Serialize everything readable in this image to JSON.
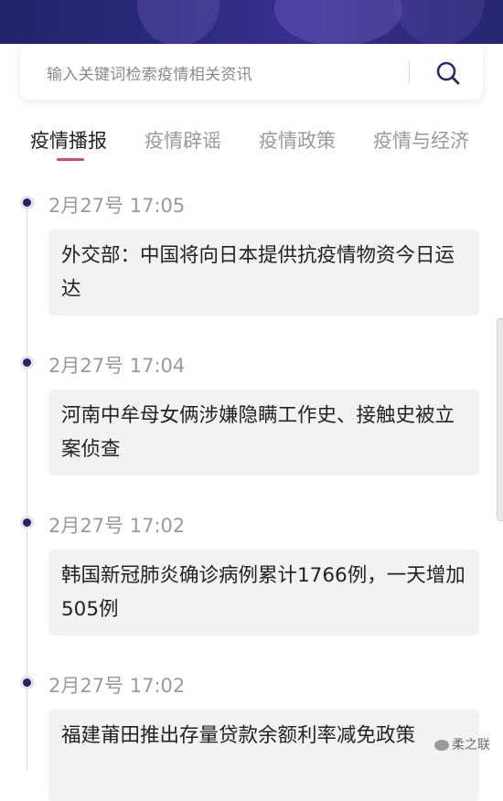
{
  "search": {
    "placeholder": "输入关键词检索疫情相关资讯",
    "icon": "search-icon"
  },
  "tabs": [
    {
      "label": "疫情播报",
      "active": true
    },
    {
      "label": "疫情辟谣",
      "active": false
    },
    {
      "label": "疫情政策",
      "active": false
    },
    {
      "label": "疫情与经济",
      "active": false
    }
  ],
  "timeline": [
    {
      "time": "2月27号 17:05",
      "text": "外交部：中国将向日本提供抗疫情物资今日运达"
    },
    {
      "time": "2月27号 17:04",
      "text": "河南中牟母女俩涉嫌隐瞒工作史、接触史被立案侦查"
    },
    {
      "time": "2月27号 17:02",
      "text": "韩国新冠肺炎确诊病例累计1766例，一天增加505例"
    },
    {
      "time": "2月27号 17:02",
      "text": "福建莆田推出存量贷款余额利率减免政策"
    }
  ],
  "watermark": "柔之联",
  "colors": {
    "banner": "#2c2a80",
    "accent_underline": "#d84570",
    "timeline_dot": "#26236e",
    "card_bg": "#f2f2f2"
  }
}
